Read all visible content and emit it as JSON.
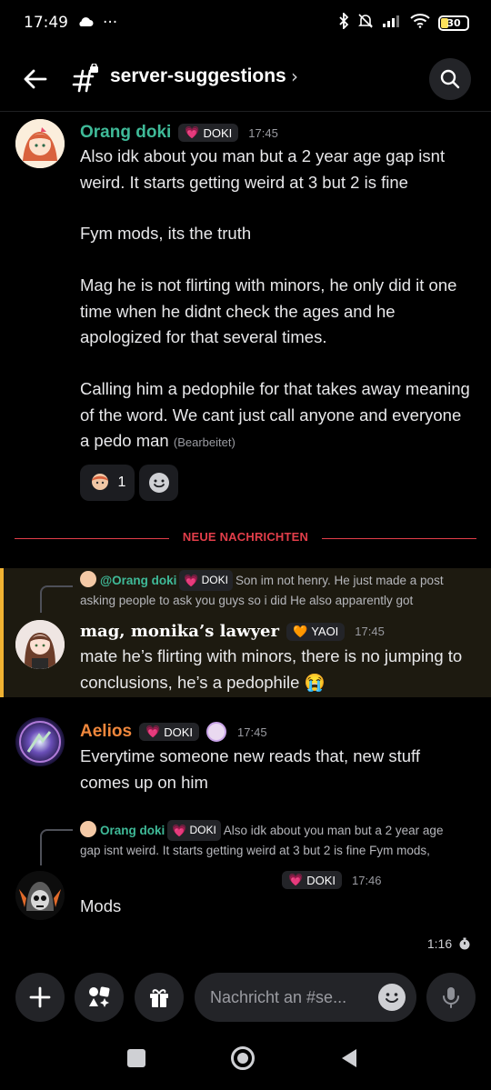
{
  "status_bar": {
    "time": "17:49",
    "dots": "···",
    "battery": "30"
  },
  "header": {
    "channel_name": "server-suggestions",
    "chevron": "›"
  },
  "message1": {
    "username": "Orang doki",
    "tag": "DOKI",
    "time": "17:45",
    "paragraphs": [
      "Also idk about you man but a 2 year age gap isnt weird. It starts getting weird at 3 but 2 is fine",
      "Fym mods, its the truth",
      "Mag he is not flirting with minors, he only did it one time when he didnt check the ages and he apologized for that several times.",
      "Calling him a pedophile for that takes away meaning of the word. We cant just call anyone and everyone a pedo man"
    ],
    "edited": "(Bearbeitet)",
    "reaction_count": "1"
  },
  "new_messages_label": "NEUE NACHRICHTEN",
  "message2": {
    "reply": {
      "name": "@Orang doki",
      "tag": "DOKI",
      "text_line1": "Son im not henry. He just made a post",
      "text_line2": "asking people to ask you guys so i did  He also apparently got"
    },
    "username": "mag, monika’s lawyer",
    "tag": "YAOI",
    "time": "17:45",
    "text": "mate he’s flirting with minors, there is no jumping to conclusions, he’s a pedophile 😭"
  },
  "message3": {
    "username": "Aelios",
    "tag": "DOKI",
    "time": "17:45",
    "text": "Everytime someone new reads that, new stuff comes up on him"
  },
  "message4": {
    "reply": {
      "name": "Orang doki",
      "tag": "DOKI",
      "text_line1": "Also idk about you man but a 2 year age",
      "text_line2": "gap isnt weird. It starts getting weird at 3 but 2 is fine  Fym mods,"
    },
    "tag": "DOKI",
    "time": "17:46",
    "text": "Mods"
  },
  "timer": "1:16",
  "input": {
    "placeholder": "Nachricht an #se..."
  },
  "colors": {
    "orang": "#3fba98",
    "mag": "#ffffff",
    "aelios": "#f0873c",
    "new_line": "#e23e4a",
    "highlight_bar": "#f0b232"
  }
}
